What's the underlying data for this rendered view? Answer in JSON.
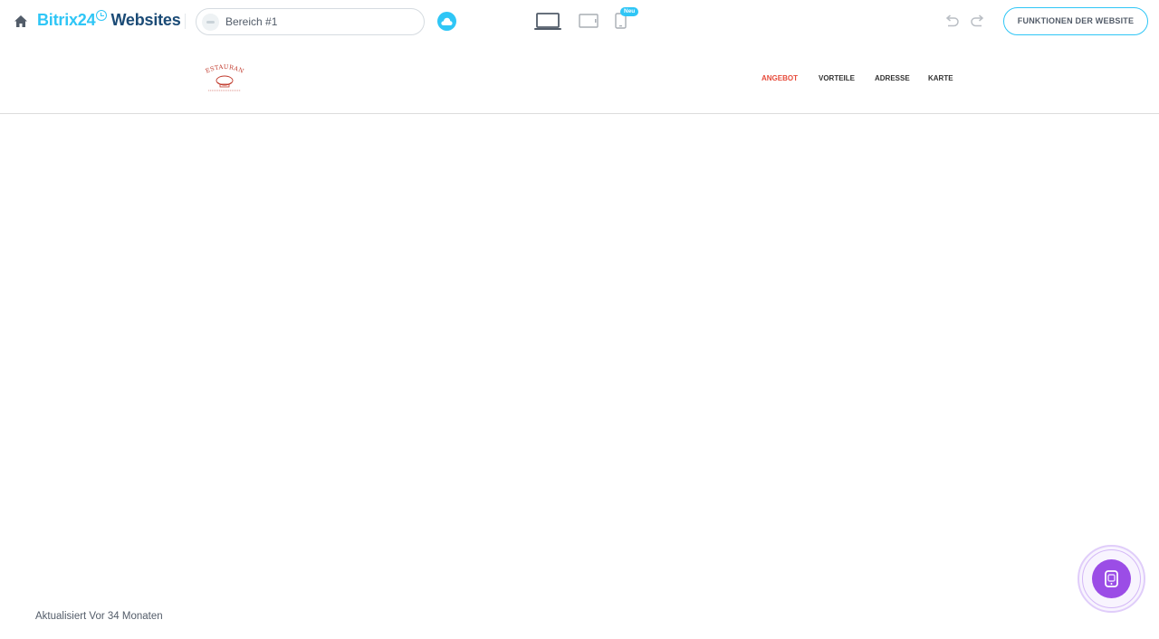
{
  "toolbar": {
    "home_icon": "home-icon",
    "brand_prefix": "Bitrix24",
    "brand_suffix": "Websites",
    "section_label": "Bereich #1",
    "cloud_icon": "cloud-icon",
    "devices": [
      "desktop-icon",
      "tablet-icon",
      "mobile-icon"
    ],
    "new_badge": "Neu",
    "features_button": "FUNKTIONEN DER WEBSITE",
    "accent": "#2fc6f6",
    "brand_dark": "#1b4b76"
  },
  "site": {
    "logo_alt": "RESTAURANT",
    "nav": [
      "ANGEBOT",
      "VORTEILE",
      "ADRESSE",
      "KARTE"
    ],
    "active_nav_color": "#e74c3c"
  },
  "footer": {
    "updated": "Aktualisiert Vor 34 Monaten"
  },
  "assistant": {
    "icon": "assistant-icon",
    "color": "#9b4de6"
  }
}
